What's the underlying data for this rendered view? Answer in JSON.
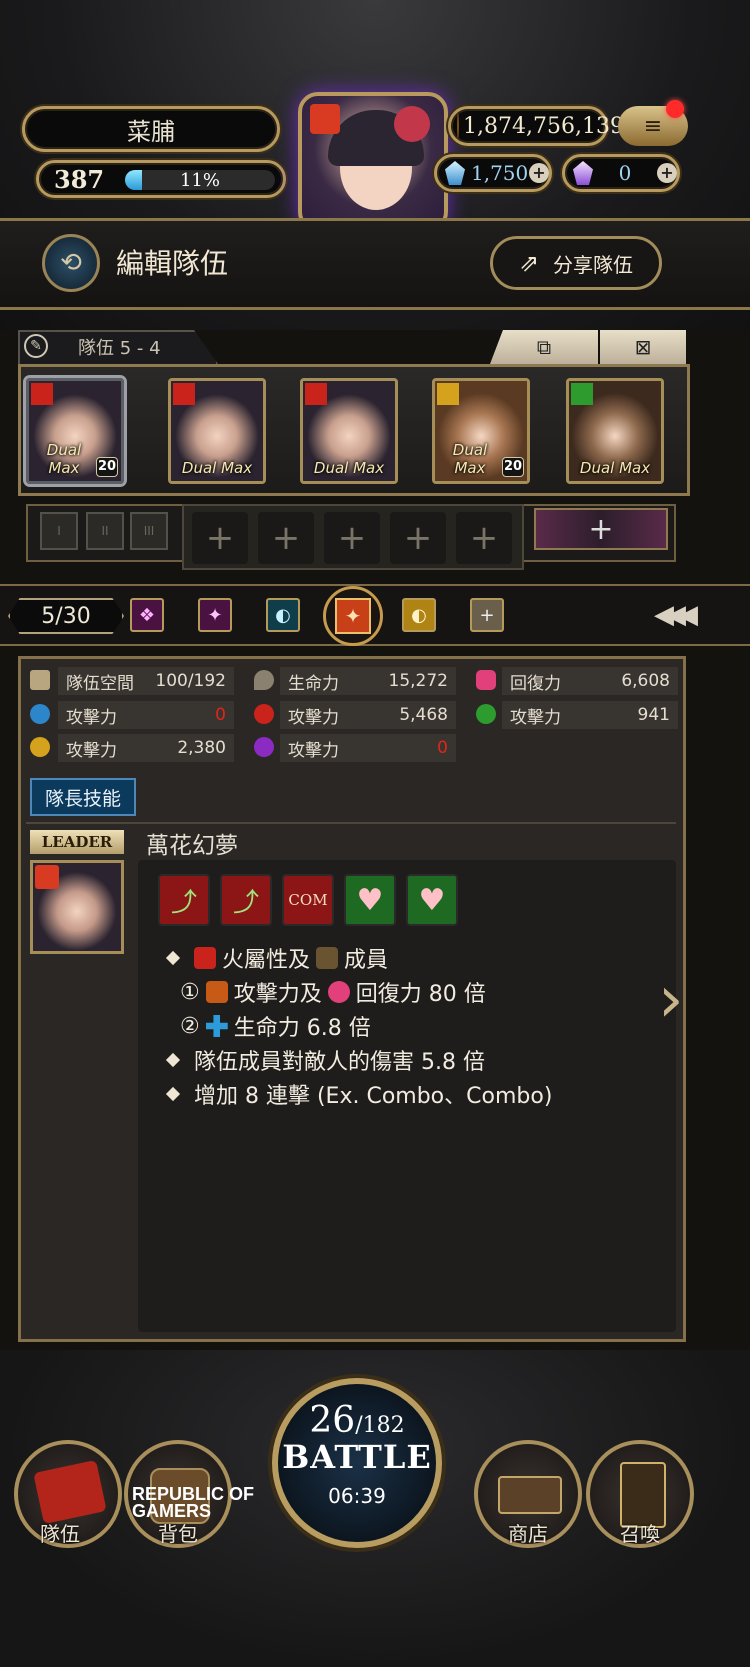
{
  "header": {
    "player_name": "菜脯",
    "level": "387",
    "exp_percent_text": "11%",
    "exp_fraction": 0.11,
    "coins": "1,874,756,139",
    "diamonds": "1,750",
    "crystals": "0",
    "menu_icon": "≡",
    "plus": "+"
  },
  "edit_bar": {
    "title": "編輯隊伍",
    "share_label": "分享隊伍",
    "back_icon": "⟲",
    "share_icon": "⇗"
  },
  "team": {
    "tab_label": "隊伍 5 - 4",
    "copy_icon": "⧉",
    "clear_icon": "⊠",
    "members": [
      {
        "label": "Dual Max",
        "level": "20",
        "attr": "fire",
        "selected": true
      },
      {
        "label": "Dual Max",
        "level": "",
        "attr": "fire",
        "selected": false
      },
      {
        "label": "Dual Max",
        "level": "",
        "attr": "fire",
        "selected": false
      },
      {
        "label": "Dual Max",
        "level": "20",
        "attr": "light",
        "selected": false
      },
      {
        "label": "Dual Max",
        "level": "",
        "attr": "wood",
        "selected": false
      }
    ],
    "mini_slots": [
      "I",
      "II",
      "III"
    ],
    "plus_slots": [
      "+",
      "+",
      "+",
      "+",
      "+"
    ],
    "add_slot": "+"
  },
  "filter": {
    "count": "5/30",
    "icons": [
      "beast-filter",
      "butterfly-filter",
      "water-filter",
      "elf-filter-selected",
      "light-filter",
      "add-filter"
    ],
    "collapse_icon": "«"
  },
  "stats": {
    "space_label": "隊伍空間",
    "space_value": "100/192",
    "hp_label": "生命力",
    "hp_value": "15,272",
    "heal_label": "回復力",
    "heal_value": "6,608",
    "atk_label": "攻擊力",
    "atk_water": "0",
    "atk_fire": "5,468",
    "atk_wood": "941",
    "atk_light": "2,380",
    "atk_dark": "0"
  },
  "leader": {
    "button_label": "隊長技能",
    "tag": "LEADER",
    "skill_name": "萬花幻夢",
    "badge_com": "COM",
    "line1": "火屬性及",
    "line1b": "成員",
    "line2_num": "①",
    "line2": "攻擊力及",
    "line2b": "回復力 80 倍",
    "line3_num": "②",
    "line3": "生命力 6.8 倍",
    "line4": "隊伍成員對敵人的傷害 5.8 倍",
    "line5": "增加 8 連擊 (Ex. Combo、Combo)"
  },
  "bottom_nav": {
    "team": "隊伍",
    "bag": "背包",
    "shop": "商店",
    "summon": "召喚",
    "battle_current": "26",
    "battle_total": "/182",
    "battle_word": "BATTLE",
    "battle_timer": "06:39",
    "logo_line1": "REPUBLIC OF",
    "logo_line2": "GAMERS"
  },
  "colors": {
    "gold": "#b89a5e",
    "fire": "#c9231b",
    "water": "#2d86c9",
    "wood": "#2d9b2d",
    "light": "#d4a21c",
    "dark": "#8b2bc4",
    "heart": "#e2407a",
    "stat_zero": "#e0251c"
  }
}
